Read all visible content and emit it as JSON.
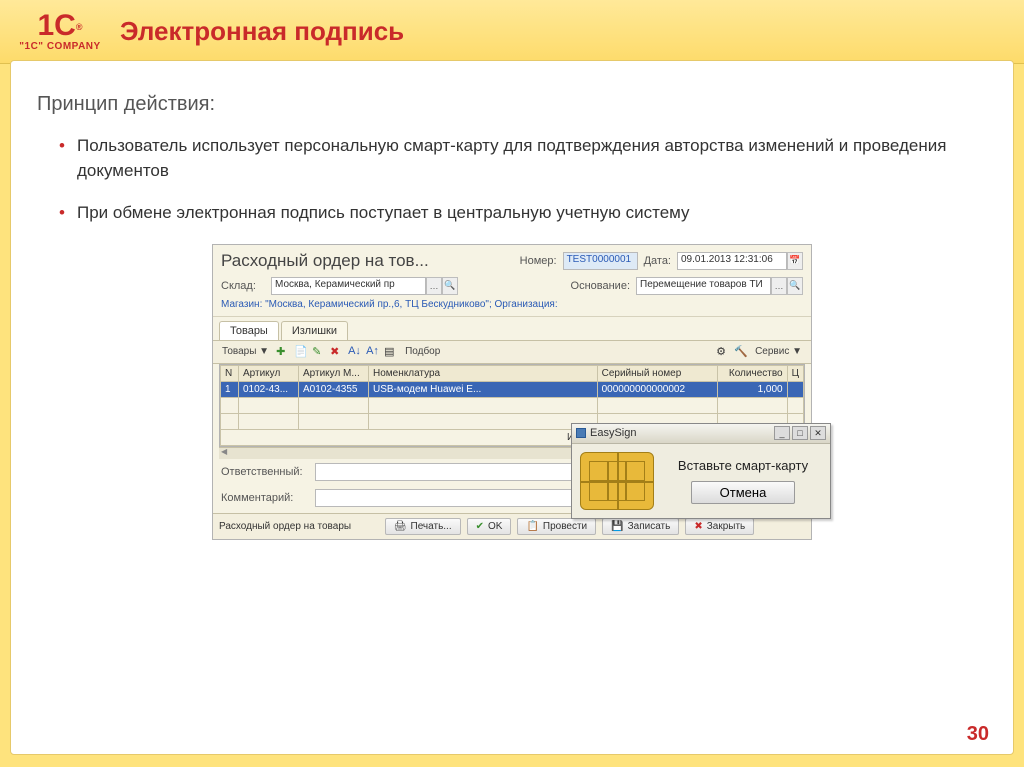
{
  "logo": {
    "main": "1C",
    "sup": "®",
    "sub": "\"1C\" COMPANY"
  },
  "title": "Электронная подпись",
  "subtitle": "Принцип действия:",
  "bullets": [
    "Пользователь использует персональную смарт-карту для подтверждения авторства изменений и проведения документов",
    "При обмене электронная подпись поступает в центральную учетную систему"
  ],
  "doc": {
    "title": "Расходный ордер на тов...",
    "number_label": "Номер:",
    "number_value": "TEST0000001",
    "date_label": "Дата:",
    "date_value": "09.01.2013 12:31:06",
    "sklad_label": "Склад:",
    "sklad_value": "Москва, Керамический пр",
    "osn_label": "Основание:",
    "osn_value": "Перемещение товаров ТИ",
    "blue_line": "Магазин: \"Москва, Керамический пр.,6, ТЦ Бескудниково\"; Организация:",
    "tabs": [
      "Товары",
      "Излишки"
    ],
    "toolbar": {
      "left": "Товары ▼",
      "podbor": "Подбор",
      "service": "Сервис ▼"
    },
    "columns": [
      "N",
      "Артикул",
      "Артикул М...",
      "Номенклатура",
      "Серийный номер",
      "Количество",
      "Ц"
    ],
    "row": {
      "n": "1",
      "art": "0102-43...",
      "artm": "A0102-4355",
      "nom": "USB-модем Huawei E...",
      "serial": "000000000000002",
      "qty": "1,000"
    },
    "itog": "Итог:",
    "otv_label": "Ответственный:",
    "komm_label": "Комментарий:",
    "status_title": "Расходный ордер на товары",
    "print": "Печать...",
    "ok": "OK",
    "provesti": "Провести",
    "zapisat": "Записать",
    "zakryt": "Закрыть"
  },
  "modal": {
    "title": "EasySign",
    "msg": "Вставьте смарт-карту",
    "cancel": "Отмена"
  },
  "page": "30"
}
